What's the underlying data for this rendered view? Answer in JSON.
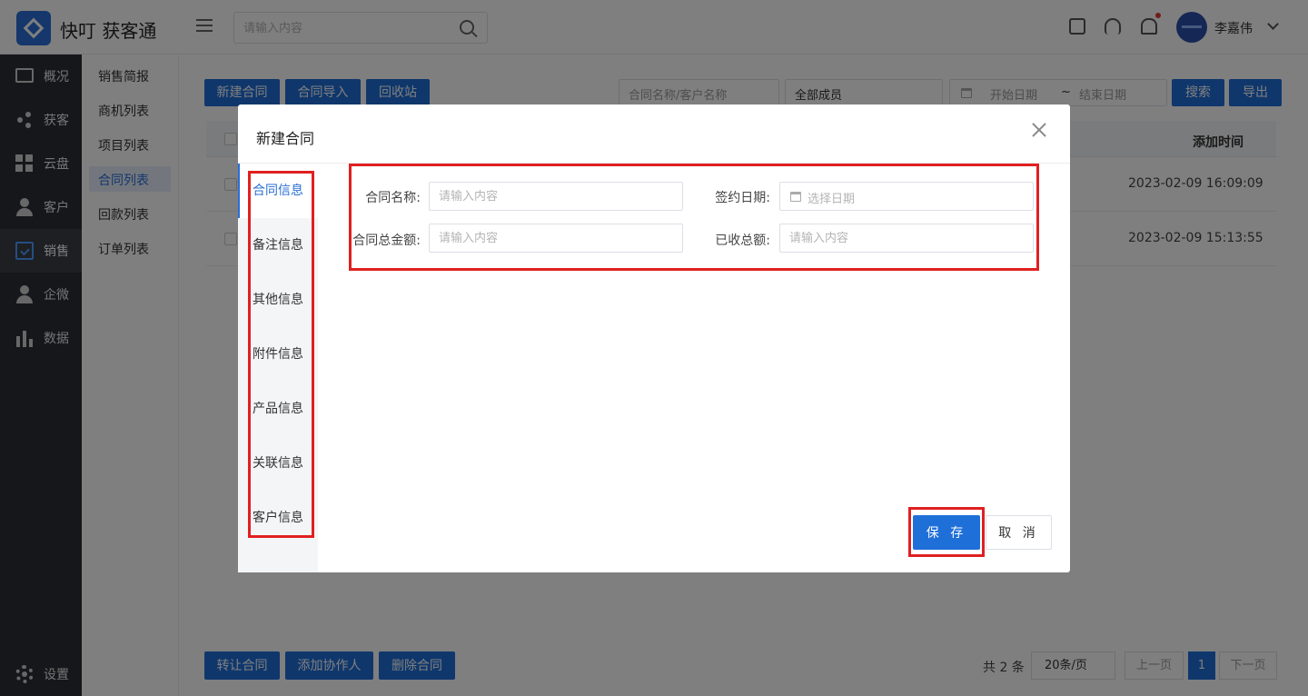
{
  "app": {
    "title": "快叮 获客通"
  },
  "header": {
    "search": {
      "placeholder": "请输入内容"
    },
    "user": {
      "name": "李嘉伟"
    }
  },
  "sidebar": {
    "items": [
      {
        "label": "概况",
        "icon": "monitor-icon"
      },
      {
        "label": "获客",
        "icon": "share-icon"
      },
      {
        "label": "云盘",
        "icon": "grid-icon"
      },
      {
        "label": "客户",
        "icon": "person-icon"
      },
      {
        "label": "销售",
        "icon": "clipboard-check-icon",
        "active": true
      },
      {
        "label": "企微",
        "icon": "person-icon"
      },
      {
        "label": "数据",
        "icon": "bar-chart-icon"
      }
    ],
    "settings": {
      "label": "设置",
      "icon": "gear-icon"
    }
  },
  "submenu": {
    "items": [
      "销售简报",
      "商机列表",
      "项目列表",
      "合同列表",
      "回款列表",
      "订单列表"
    ],
    "active": "合同列表"
  },
  "toolbar": {
    "new_contract": "新建合同",
    "import_contract": "合同导入",
    "recycle_bin": "回收站",
    "filter_placeholder": "合同名称/客户名称",
    "member_select": "全部成员",
    "start_date_placeholder": "开始日期",
    "date_separator": "~",
    "end_date_placeholder": "结束日期",
    "search": "搜索",
    "export": "导出"
  },
  "table": {
    "header_time": "添加时间",
    "rows": [
      {
        "time": "2023-02-09 16:09:09"
      },
      {
        "time": "2023-02-09 15:13:55"
      }
    ]
  },
  "footer": {
    "transfer": "转让合同",
    "add_collaborator": "添加协作人",
    "delete": "删除合同",
    "total": "共 2 条",
    "page_size": "20条/页",
    "prev": "上一页",
    "current_page": "1",
    "next": "下一页"
  },
  "dialog": {
    "title": "新建合同",
    "tabs": [
      "合同信息",
      "备注信息",
      "其他信息",
      "附件信息",
      "产品信息",
      "关联信息",
      "客户信息"
    ],
    "active_tab": "合同信息",
    "fields": {
      "contract_name": {
        "label": "合同名称:",
        "placeholder": "请输入内容"
      },
      "sign_date": {
        "label": "签约日期:",
        "placeholder": "选择日期"
      },
      "total_amount": {
        "label": "合同总金额:",
        "placeholder": "请输入内容"
      },
      "received_amount": {
        "label": "已收总额:",
        "placeholder": "请输入内容"
      }
    },
    "save": "保 存",
    "cancel": "取 消"
  },
  "colors": {
    "primary": "#1f6fd9",
    "sidebar_bg": "#2b2f36",
    "highlight": "#e02020"
  }
}
